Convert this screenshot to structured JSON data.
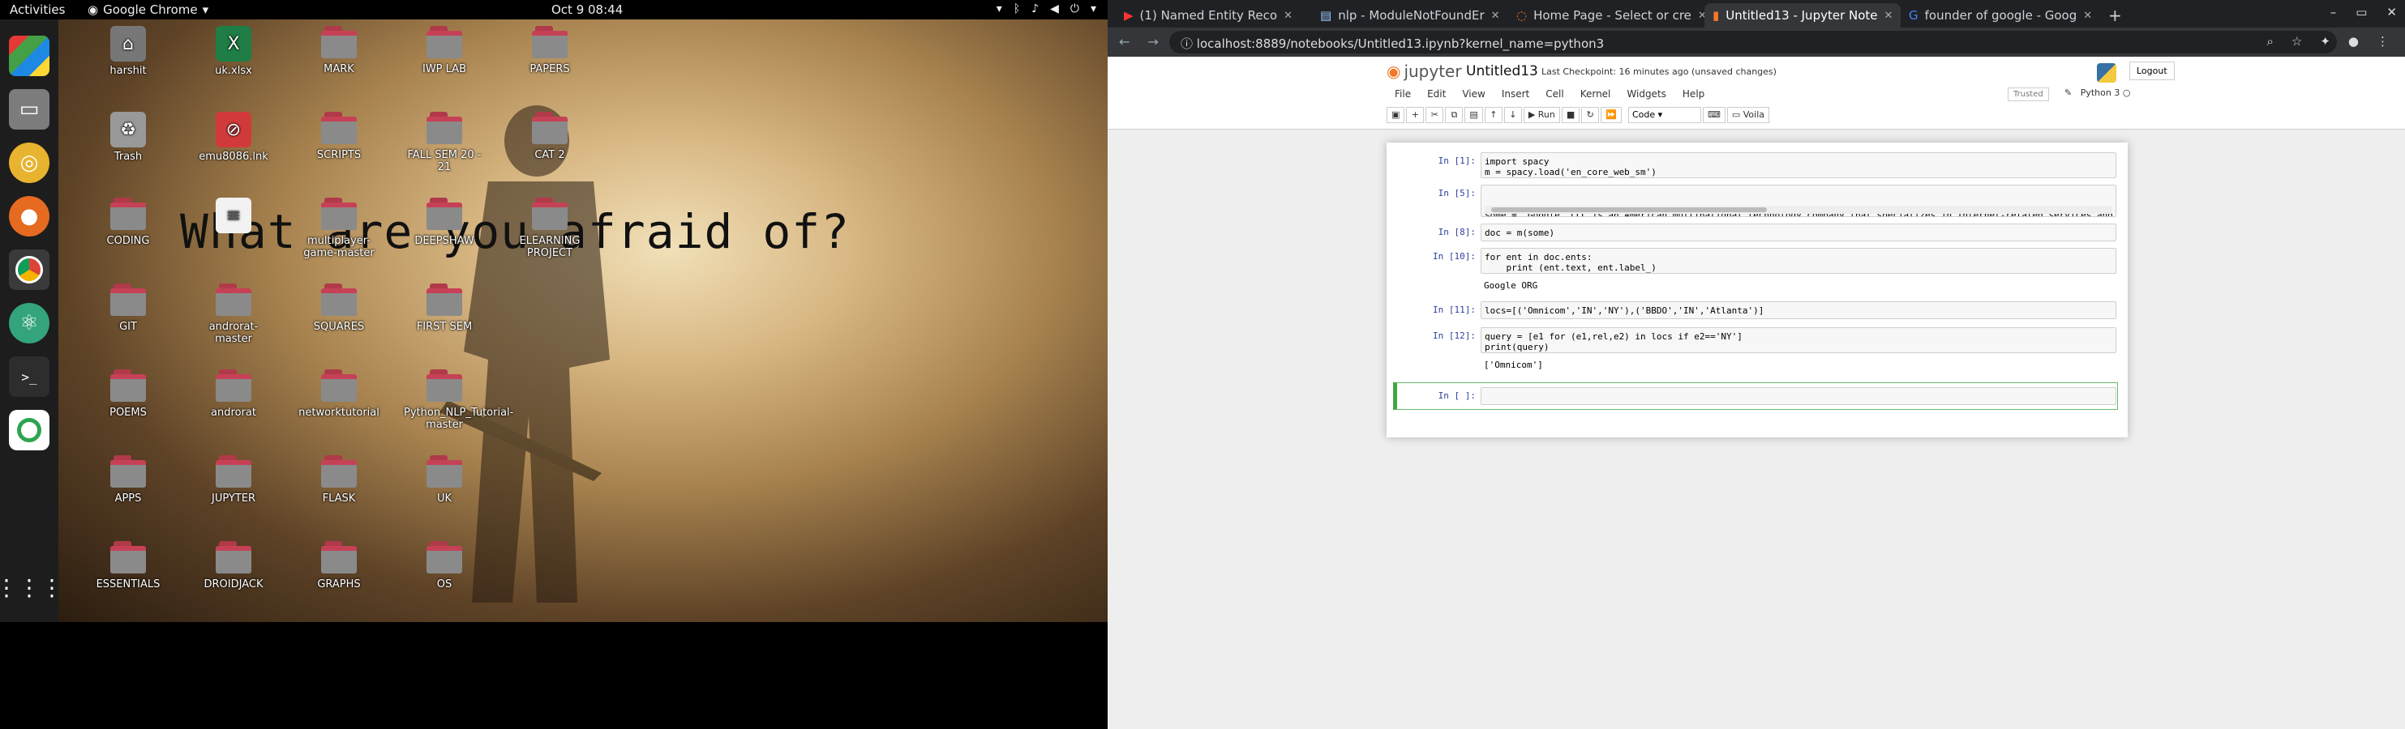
{
  "topbar": {
    "activities": "Activities",
    "app_name": "Google Chrome",
    "clock": "Oct 9  08:44"
  },
  "dock": {
    "icons": [
      "app-grid-icon",
      "files-icon",
      "rhythmbox-icon",
      "firefox-icon",
      "chrome-icon",
      "atom-icon",
      "terminal-icon",
      "circle-app-icon",
      "show-apps-icon"
    ]
  },
  "desktop": {
    "wallpaper_text": "What are you afraid of?",
    "icons": [
      {
        "label": "harshit",
        "type": "home"
      },
      {
        "label": "uk.xlsx",
        "type": "xlsx"
      },
      {
        "label": "MARK",
        "type": "folder"
      },
      {
        "label": "IWP LAB",
        "type": "folder"
      },
      {
        "label": "PAPERS",
        "type": "folder"
      },
      {
        "label": "Trash",
        "type": "trash"
      },
      {
        "label": "emu8086.lnk",
        "type": "lnk"
      },
      {
        "label": "SCRIPTS",
        "type": "folder"
      },
      {
        "label": "FALL SEM 20 - 21",
        "type": "folder"
      },
      {
        "label": "CAT 2",
        "type": "folder"
      },
      {
        "label": "CODING",
        "type": "folder"
      },
      {
        "label": "",
        "type": "file"
      },
      {
        "label": "multiplayer-game-master",
        "type": "folder"
      },
      {
        "label": "DEEPSHAW",
        "type": "folder"
      },
      {
        "label": "ELEARNING PROJECT",
        "type": "folder"
      },
      {
        "label": "GIT",
        "type": "folder"
      },
      {
        "label": "androrat-master",
        "type": "folder"
      },
      {
        "label": "SQUARES",
        "type": "folder"
      },
      {
        "label": "FIRST SEM",
        "type": "folder"
      },
      {
        "label": "POEMS",
        "type": "folder"
      },
      {
        "label": "androrat",
        "type": "folder"
      },
      {
        "label": "networktutorial",
        "type": "folder"
      },
      {
        "label": "Python_NLP_Tutorial-master",
        "type": "folder"
      },
      {
        "label": "APPS",
        "type": "folder"
      },
      {
        "label": "JUPYTER",
        "type": "folder"
      },
      {
        "label": "FLASK",
        "type": "folder"
      },
      {
        "label": "UK",
        "type": "folder"
      },
      {
        "label": "ESSENTIALS",
        "type": "folder"
      },
      {
        "label": "DROIDJACK",
        "type": "folder"
      },
      {
        "label": "GRAPHS",
        "type": "folder"
      },
      {
        "label": "OS",
        "type": "folder"
      }
    ]
  },
  "browser": {
    "tabs": [
      {
        "title": "(1) Named Entity Reco",
        "active": false
      },
      {
        "title": "nlp - ModuleNotFoundEr",
        "active": false
      },
      {
        "title": "Home Page - Select or cre",
        "active": false
      },
      {
        "title": "Untitled13 - Jupyter Note",
        "active": true
      },
      {
        "title": "founder of google - Goog",
        "active": false
      }
    ],
    "new_tab": "+",
    "url": "localhost:8889/notebooks/Untitled13.ipynb?kernel_name=python3"
  },
  "jupyter": {
    "logo": "jupyter",
    "notebook_name": "Untitled13",
    "checkpoint": "Last Checkpoint: 16 minutes ago",
    "unsaved": "(unsaved changes)",
    "logout": "Logout",
    "menu": [
      "File",
      "Edit",
      "View",
      "Insert",
      "Cell",
      "Kernel",
      "Widgets",
      "Help"
    ],
    "trusted": "Trusted",
    "kernel": "Python 3",
    "toolbar": {
      "run": "Run",
      "cell_type": "Code",
      "voila": "Voila"
    },
    "cells": [
      {
        "prompt": "In [1]:",
        "code": "import spacy\nm = spacy.load('en_core_web_sm')",
        "output": ""
      },
      {
        "prompt": "In [5]:",
        "code": "some = 'Google, LLC is an American multinational technology company that specializes in Internet-related services and",
        "output": ""
      },
      {
        "prompt": "In [8]:",
        "code": "doc = m(some)",
        "output": ""
      },
      {
        "prompt": "In [10]:",
        "code": "for ent in doc.ents:\n    print (ent.text, ent.label_)",
        "output": "Google ORG"
      },
      {
        "prompt": "In [11]:",
        "code": "locs=[('Omnicom','IN','NY'),('BBDO','IN','Atlanta')]",
        "output": ""
      },
      {
        "prompt": "In [12]:",
        "code": "query = [e1 for (e1,rel,e2) in locs if e2=='NY']\nprint(query)",
        "output": "['Omnicom']"
      },
      {
        "prompt": "In [ ]:",
        "code": "",
        "output": ""
      }
    ]
  }
}
